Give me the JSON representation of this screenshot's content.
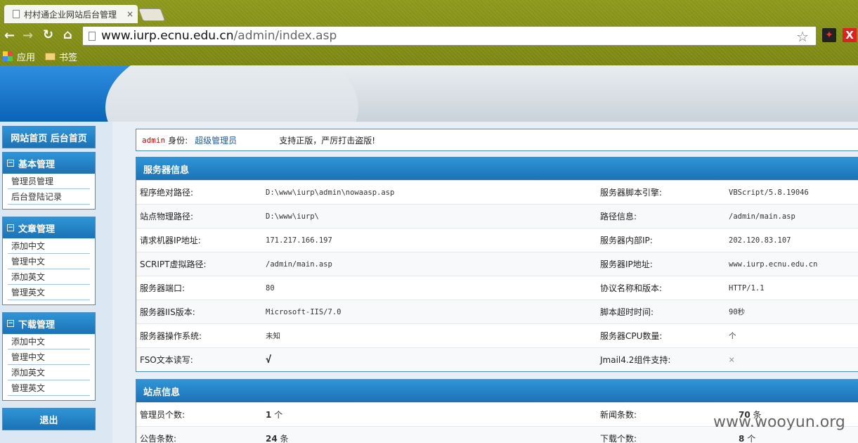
{
  "browser": {
    "tab_title": "村村通企业网站后台管理",
    "tab_close": "×",
    "url_host": "www.iurp.ecnu.edu.cn",
    "url_path": "/admin/index.asp",
    "bookmarks": [
      "应用",
      "书签"
    ]
  },
  "sidebar": {
    "top_links": "网站首页  后台首页",
    "sections": [
      {
        "title": "基本管理",
        "items": [
          "管理员管理",
          "后台登陆记录"
        ]
      },
      {
        "title": "文章管理",
        "items": [
          "添加中文",
          "管理中文",
          "添加英文",
          "管理英文"
        ]
      },
      {
        "title": "下载管理",
        "items": [
          "添加中文",
          "管理中文",
          "添加英文",
          "管理英文"
        ]
      }
    ],
    "logout": "退出"
  },
  "notice": {
    "admin_name": "admin",
    "identity_label": "身份:",
    "role": "超级管理员",
    "slogan": "支持正版，严厉打击盗版!"
  },
  "server_info": {
    "title": "服务器信息",
    "rows": [
      [
        "程序绝对路径:",
        "D:\\www\\iurp\\admin\\nowaasp.asp",
        "服务器脚本引擎:",
        "VBScript/5.8.19046"
      ],
      [
        "站点物理路径:",
        "D:\\www\\iurp\\",
        "路径信息:",
        "/admin/main.asp"
      ],
      [
        "请求机器IP地址:",
        "171.217.166.197",
        "服务器内部IP:",
        "202.120.83.107"
      ],
      [
        "SCRIPT虚拟路径:",
        "/admin/main.asp",
        "服务器IP地址:",
        "www.iurp.ecnu.edu.cn"
      ],
      [
        "服务器端口:",
        "80",
        "协议名称和版本:",
        "HTTP/1.1"
      ],
      [
        "服务器IIS版本:",
        "Microsoft-IIS/7.0",
        "脚本超时时间:",
        "90秒"
      ],
      [
        "服务器操作系统:",
        "未知",
        "服务器CPU数量:",
        "个"
      ],
      [
        "FSO文本读写:",
        "√",
        "Jmail4.2组件支持:",
        "×"
      ]
    ]
  },
  "site_info": {
    "title": "站点信息",
    "rows": [
      {
        "l1": "管理员个数:",
        "v1": "1",
        "u1": "个",
        "l2": "新闻条数:",
        "v2": "70",
        "u2": "条"
      },
      {
        "l1": "公告条数:",
        "v1": "24",
        "u1": "条",
        "l2": "下载个数:",
        "v2": "8",
        "u2": "个"
      }
    ]
  },
  "watermark": "www.wooyun.org"
}
